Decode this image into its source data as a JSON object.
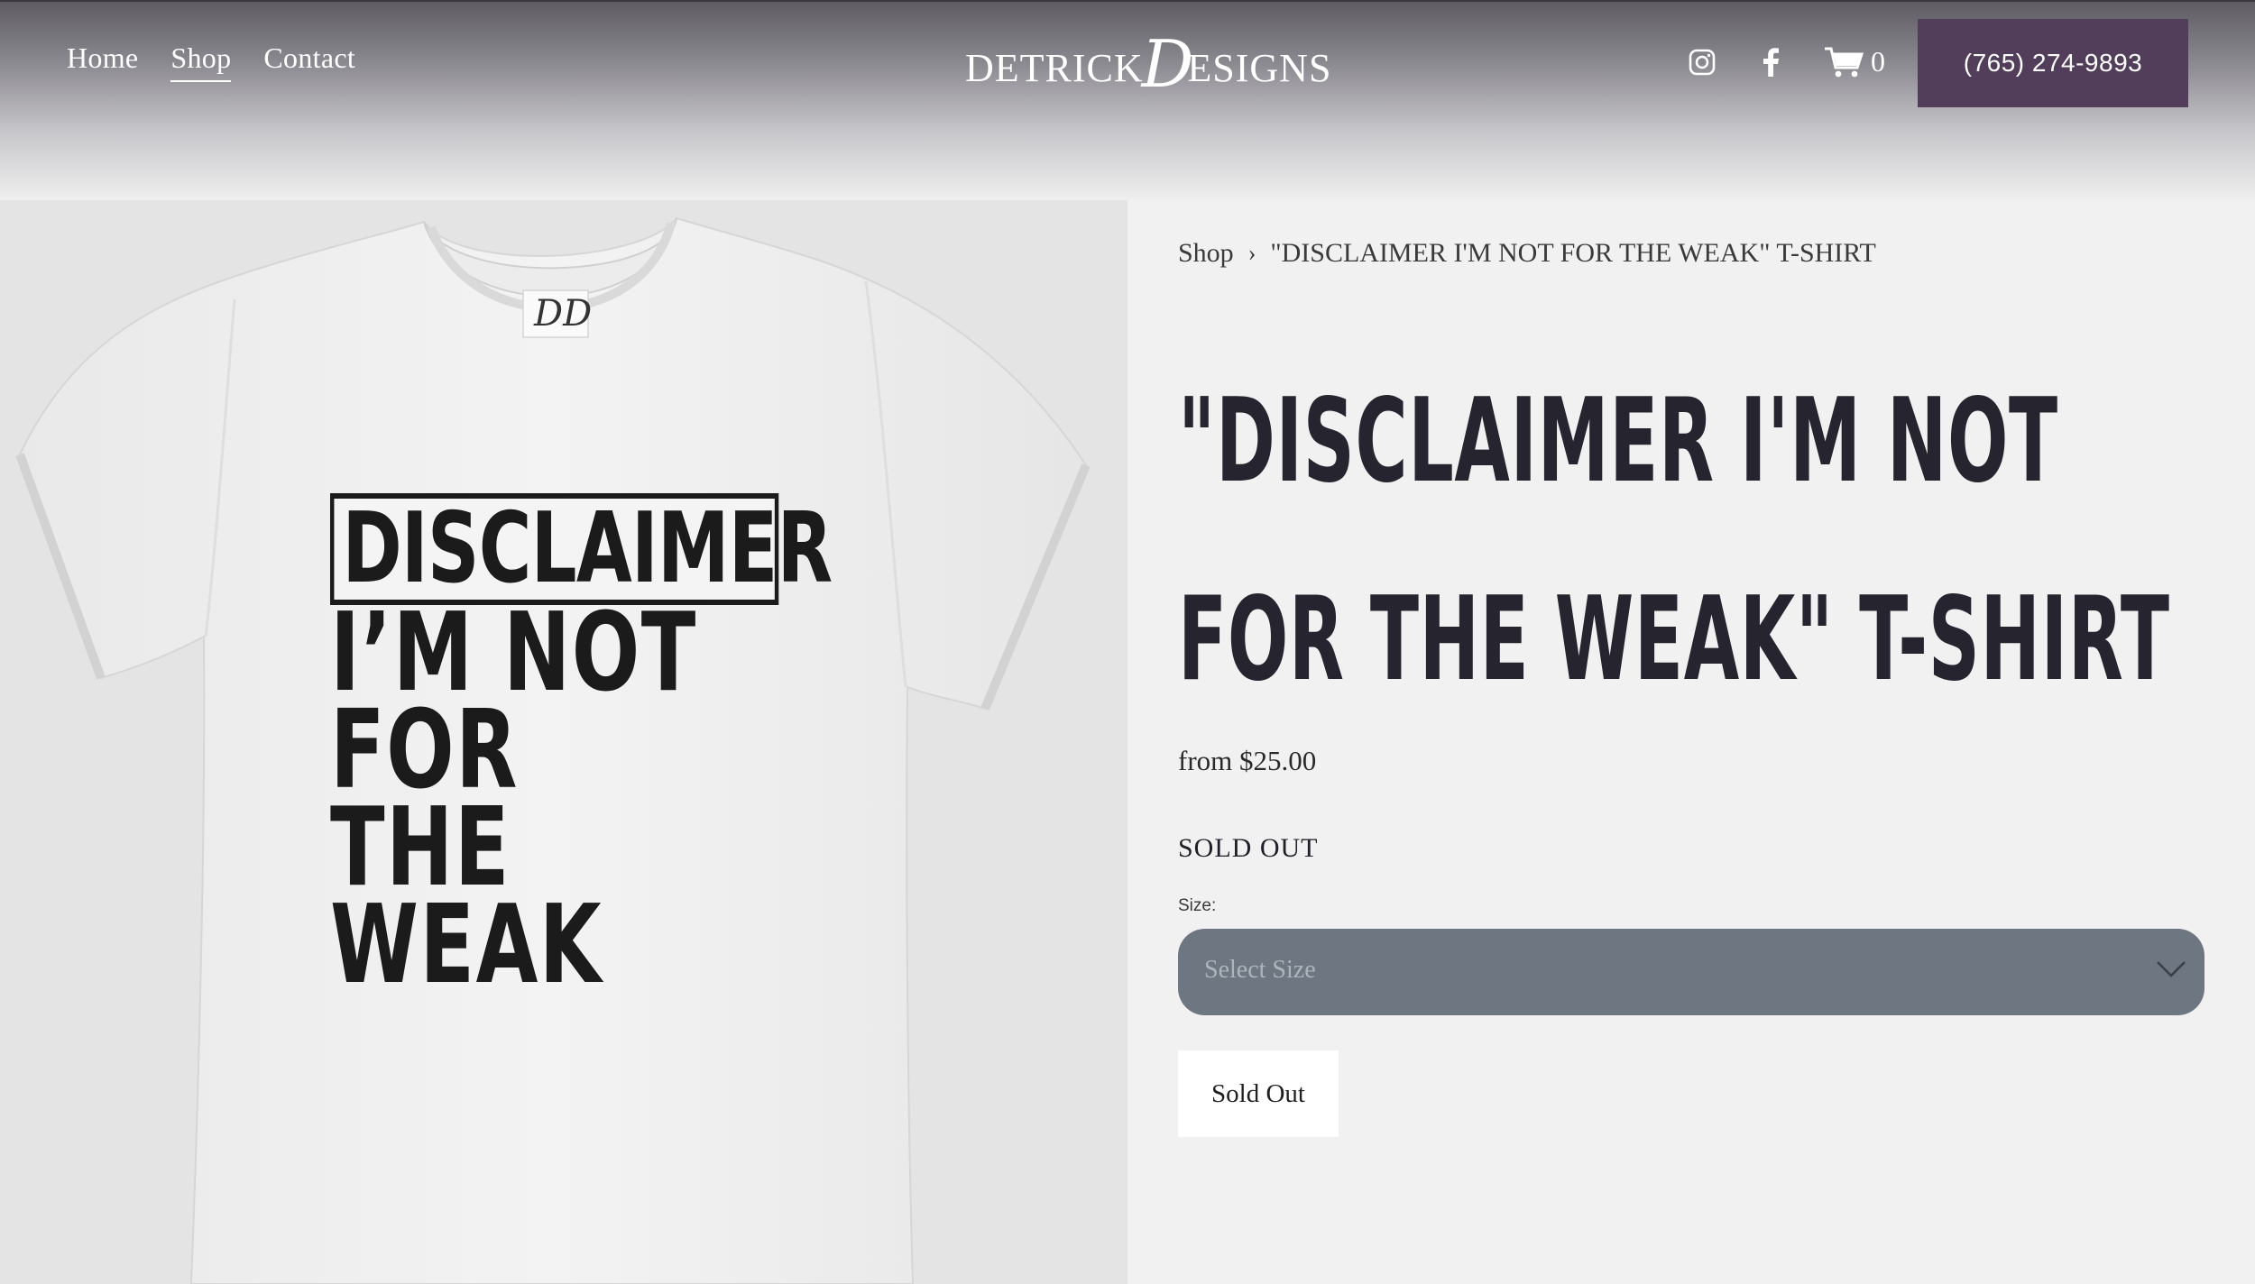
{
  "nav": {
    "items": [
      {
        "label": "Home"
      },
      {
        "label": "Shop"
      },
      {
        "label": "Contact"
      }
    ],
    "active": "Shop"
  },
  "logo": {
    "text_left": "DETRICK",
    "script_letter": "D",
    "text_right": "ESIGNS"
  },
  "header": {
    "cart_count": "0",
    "phone_label": "(765) 274-9893",
    "icons": [
      "instagram-icon",
      "facebook-icon",
      "cart-icon"
    ]
  },
  "product": {
    "image": {
      "print_line1": "DISCLAIMER",
      "print_line2": "I’M NOT FOR",
      "print_line3": "THE WEAK",
      "tag_logo": "DD"
    },
    "breadcrumb": {
      "parent": "Shop",
      "separator": "›",
      "current": "\"DISCLAIMER I'M NOT FOR THE WEAK\" T-SHIRT"
    },
    "title": "\"DISCLAIMER I'M NOT FOR THE WEAK\" T-SHIRT",
    "price": "from $25.00",
    "stock_status": "SOLD OUT",
    "size_label": "Size:",
    "size_placeholder": "Select Size",
    "button_label": "Sold Out"
  },
  "colors": {
    "accent": "#523e5b",
    "select_bg": "#6e7781",
    "title": "#26252f",
    "page_bg": "#f1f1f1"
  }
}
